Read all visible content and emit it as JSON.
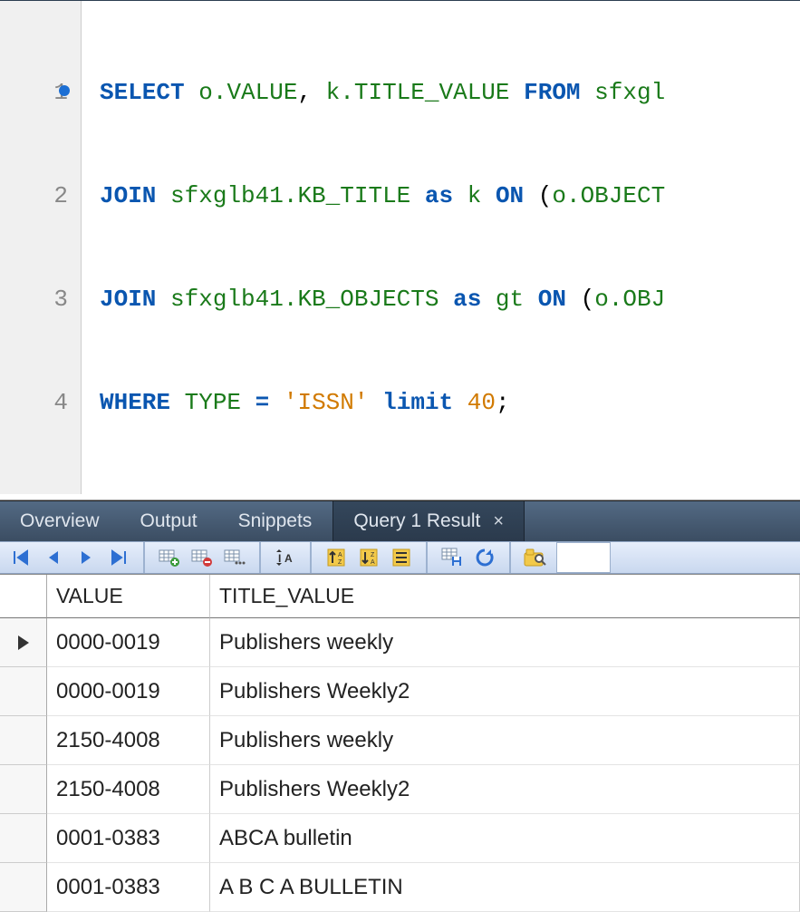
{
  "editor": {
    "lines": [
      {
        "n": "1",
        "marked": true
      },
      {
        "n": "2",
        "marked": false
      },
      {
        "n": "3",
        "marked": false
      },
      {
        "n": "4",
        "marked": false
      }
    ],
    "sql": {
      "l1": {
        "select": "SELECT",
        "v": "o.VALUE",
        "comma": ", ",
        "t": "k.TITLE_VALUE",
        "from": "FROM",
        "src": "sfxgl"
      },
      "l2": {
        "join": "JOIN",
        "tbl": "sfxglb41.KB_TITLE",
        "as": "as",
        "alias": "k",
        "on": "ON",
        "open": "(",
        "cond": "o.OBJECT"
      },
      "l3": {
        "join": "JOIN",
        "tbl": "sfxglb41.KB_OBJECTS",
        "as": "as",
        "alias": "gt",
        "on": "ON",
        "open": "(",
        "cond": "o.OBJ"
      },
      "l4": {
        "where": "WHERE",
        "type": "TYPE",
        "eq": "=",
        "str": "'ISSN'",
        "limit": "limit",
        "num": "40",
        "semi": ";"
      }
    }
  },
  "tabs": {
    "overview": "Overview",
    "output": "Output",
    "snippets": "Snippets",
    "result": "Query 1 Result",
    "close": "×"
  },
  "toolbar": {
    "icons": [
      "nav-first",
      "nav-prev",
      "nav-next",
      "nav-last",
      "sep",
      "grid-add",
      "grid-remove",
      "grid-edit",
      "sep",
      "row-height",
      "sep",
      "sort-asc",
      "sort-desc",
      "sort-group",
      "sep",
      "save",
      "refresh",
      "sep",
      "find"
    ]
  },
  "grid": {
    "columns": {
      "value": "VALUE",
      "title": "TITLE_VALUE"
    },
    "rows": [
      {
        "current": true,
        "value": "0000-0019",
        "title": "Publishers weekly"
      },
      {
        "current": false,
        "value": "0000-0019",
        "title": "Publishers Weekly2"
      },
      {
        "current": false,
        "value": "2150-4008",
        "title": "Publishers weekly"
      },
      {
        "current": false,
        "value": "2150-4008",
        "title": "Publishers Weekly2"
      },
      {
        "current": false,
        "value": "0001-0383",
        "title": "ABCA bulletin"
      },
      {
        "current": false,
        "value": "0001-0383",
        "title": "A B C A BULLETIN"
      }
    ]
  }
}
